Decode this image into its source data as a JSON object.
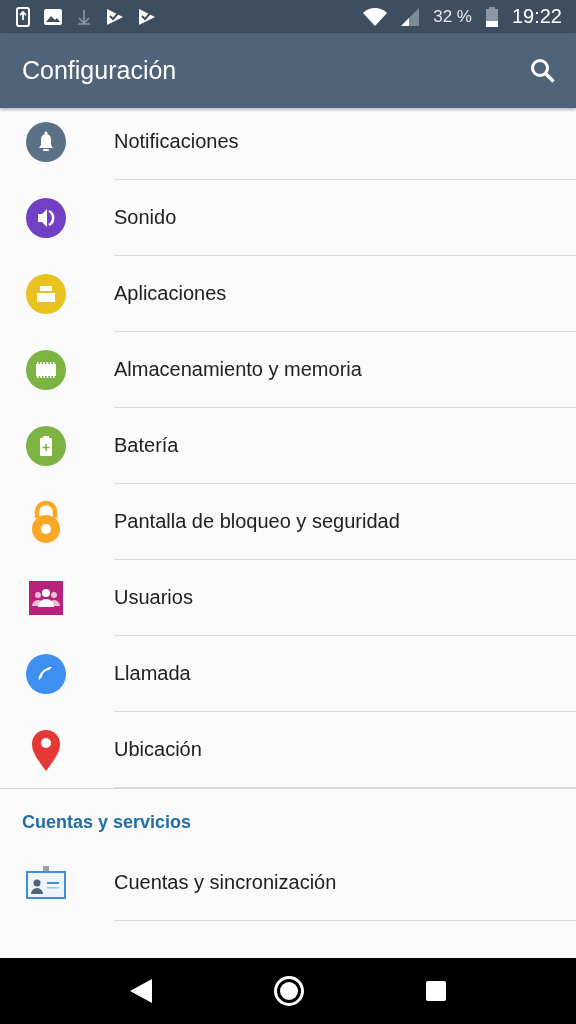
{
  "status_bar": {
    "battery_text": "32 %",
    "time": "19:22"
  },
  "app_bar": {
    "title": "Configuración"
  },
  "sections": [
    {
      "items": [
        {
          "label": "Notificaciones",
          "kind": "bell"
        },
        {
          "label": "Sonido",
          "kind": "sound"
        },
        {
          "label": "Aplicaciones",
          "kind": "apps"
        },
        {
          "label": "Almacenamiento y memoria",
          "kind": "storage"
        },
        {
          "label": "Batería",
          "kind": "battery"
        },
        {
          "label": "Pantalla de bloqueo y seguridad",
          "kind": "lock"
        },
        {
          "label": "Usuarios",
          "kind": "users"
        },
        {
          "label": "Llamada",
          "kind": "call"
        },
        {
          "label": "Ubicación",
          "kind": "location"
        }
      ]
    },
    {
      "header": "Cuentas y servicios",
      "items": [
        {
          "label": "Cuentas y sincronización",
          "kind": "accounts"
        }
      ]
    }
  ]
}
